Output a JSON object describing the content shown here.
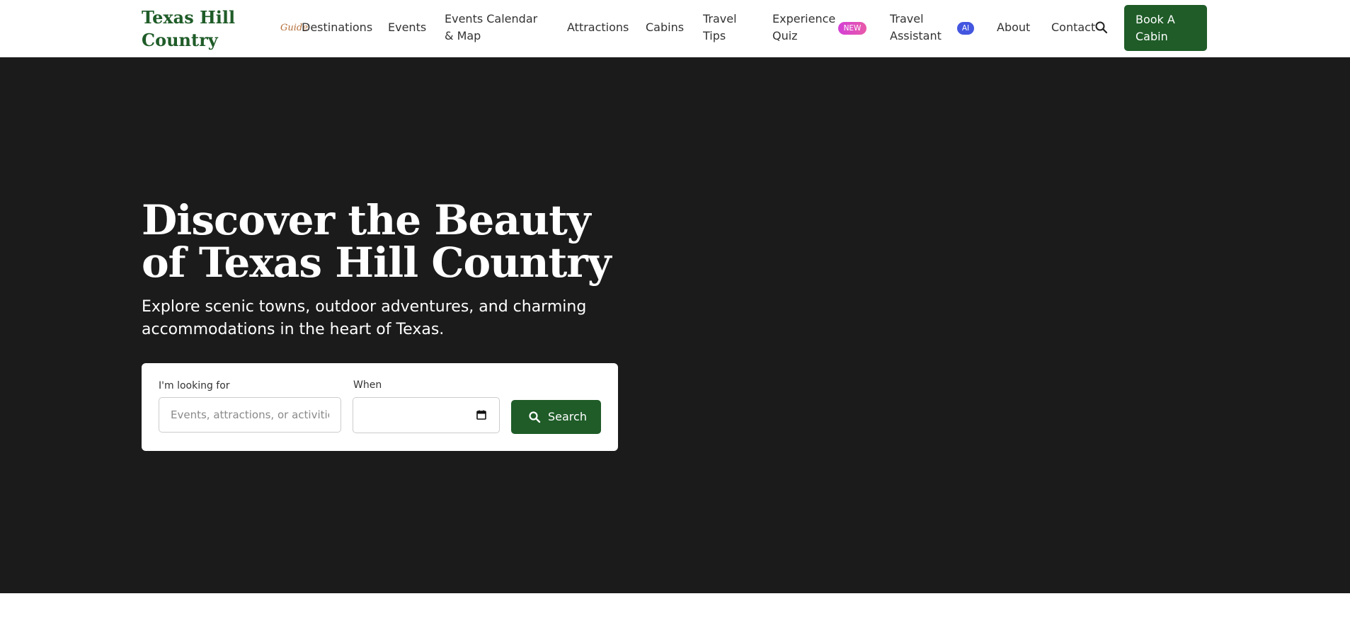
{
  "brand": {
    "name": "Texas Hill Country",
    "tag": "Guide"
  },
  "nav": {
    "items": [
      {
        "label": "Destinations"
      },
      {
        "label": "Events"
      },
      {
        "label": "Events Calendar & Map"
      },
      {
        "label": "Attractions"
      },
      {
        "label": "Cabins"
      },
      {
        "label": "Travel Tips"
      },
      {
        "label": "Experience Quiz",
        "badge": "NEW"
      },
      {
        "label": "Travel Assistant",
        "badge": "AI"
      },
      {
        "label": "About"
      },
      {
        "label": "Contact"
      }
    ],
    "search_icon": "search-icon",
    "book_button": "Book A Cabin"
  },
  "hero": {
    "title": "Discover the Beauty of Texas Hill Country",
    "subtitle": "Explore scenic towns, outdoor adventures, and charming accommodations in the heart of Texas.",
    "search": {
      "looking_for_label": "I'm looking for",
      "looking_for_placeholder": "Events, attractions, or activities",
      "looking_for_value": "",
      "when_label": "When",
      "when_value": "",
      "button_label": "Search"
    }
  },
  "colors": {
    "brand_green": "#1f5c28",
    "hero_background": "#1b1b1b",
    "guide_tag": "#b5703a",
    "new_badge": "#d43fd6",
    "ai_badge": "#4356e0"
  }
}
